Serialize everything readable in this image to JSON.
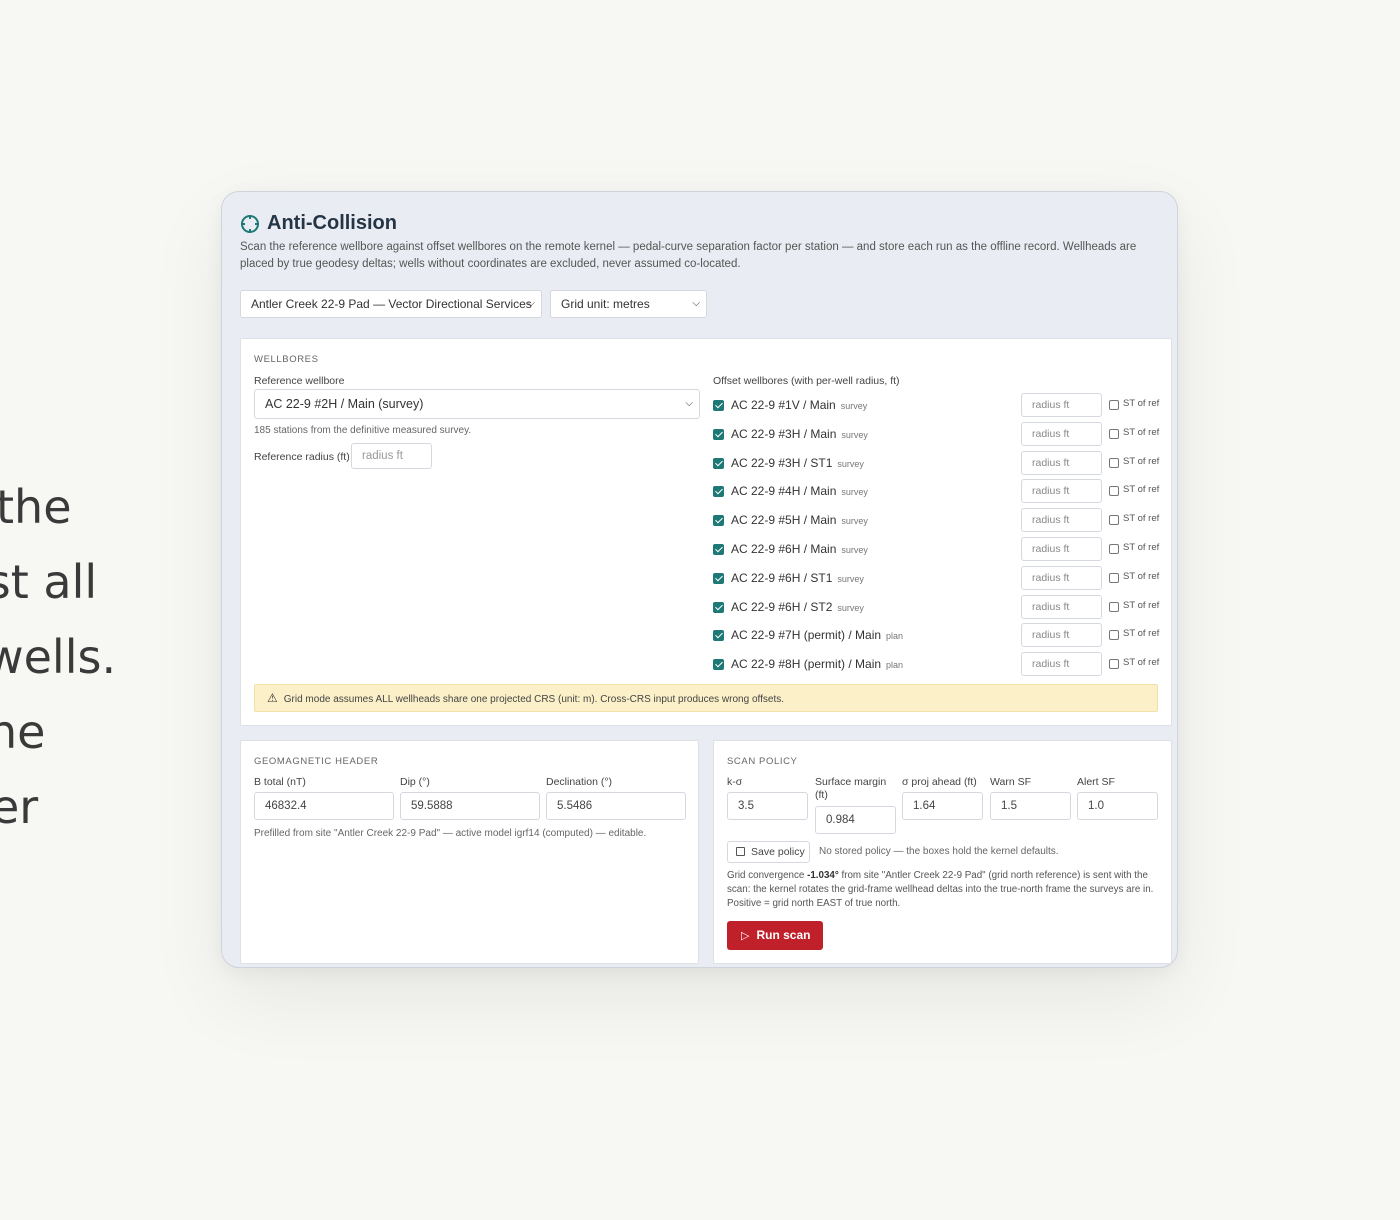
{
  "side_text": [
    "the",
    "ist all",
    "wells.",
    "he",
    "er"
  ],
  "app": {
    "title": "Anti-Collision",
    "description": "Scan the reference wellbore against offset wellbores on the remote kernel — pedal-curve separation factor per station — and store each run as the offline record. Wellheads are placed by true geodesy deltas; wells without coordinates are excluded, never assumed co-located."
  },
  "selectors": {
    "site": "Antler Creek 22-9 Pad — Vector Directional Services",
    "grid_unit": "Grid unit: metres"
  },
  "wellbores": {
    "section_label": "WELLBORES",
    "reference_label": "Reference wellbore",
    "reference_value": "AC 22-9 #2H / Main (survey)",
    "stations_hint": "185 stations from the definitive measured survey.",
    "ref_radius_label": "Reference radius (ft)",
    "ref_radius_placeholder": "radius ft",
    "offset_label": "Offset wellbores (with per-well radius, ft)",
    "offsets": [
      {
        "name": "AC 22-9 #1V / Main",
        "kind": "survey",
        "radius_placeholder": "radius ft",
        "st_label": "ST of ref"
      },
      {
        "name": "AC 22-9 #3H / Main",
        "kind": "survey",
        "radius_placeholder": "radius ft",
        "st_label": "ST of ref"
      },
      {
        "name": "AC 22-9 #3H / ST1",
        "kind": "survey",
        "radius_placeholder": "radius ft",
        "st_label": "ST of ref"
      },
      {
        "name": "AC 22-9 #4H / Main",
        "kind": "survey",
        "radius_placeholder": "radius ft",
        "st_label": "ST of ref"
      },
      {
        "name": "AC 22-9 #5H / Main",
        "kind": "survey",
        "radius_placeholder": "radius ft",
        "st_label": "ST of ref"
      },
      {
        "name": "AC 22-9 #6H / Main",
        "kind": "survey",
        "radius_placeholder": "radius ft",
        "st_label": "ST of ref"
      },
      {
        "name": "AC 22-9 #6H / ST1",
        "kind": "survey",
        "radius_placeholder": "radius ft",
        "st_label": "ST of ref"
      },
      {
        "name": "AC 22-9 #6H / ST2",
        "kind": "survey",
        "radius_placeholder": "radius ft",
        "st_label": "ST of ref"
      },
      {
        "name": "AC 22-9 #7H (permit) / Main",
        "kind": "plan",
        "radius_placeholder": "radius ft",
        "st_label": "ST of ref"
      },
      {
        "name": "AC 22-9 #8H (permit) / Main",
        "kind": "plan",
        "radius_placeholder": "radius ft",
        "st_label": "ST of ref"
      }
    ],
    "warning": "Grid mode assumes ALL wellheads share one projected CRS (unit: m). Cross-CRS input produces wrong offsets."
  },
  "geomagnetic": {
    "section_label": "GEOMAGNETIC HEADER",
    "fields": [
      {
        "label": "B total (nT)",
        "value": "46832.4"
      },
      {
        "label": "Dip (°)",
        "value": "59.5888"
      },
      {
        "label": "Declination (°)",
        "value": "5.5486"
      }
    ],
    "hint": "Prefilled from site \"Antler Creek 22-9 Pad\" — active model igrf14 (computed) — editable."
  },
  "scan_policy": {
    "section_label": "SCAN POLICY",
    "fields": [
      {
        "label": "k-σ",
        "value": "3.5"
      },
      {
        "label": "Surface margin (ft)",
        "value": "0.984"
      },
      {
        "label": "σ proj ahead (ft)",
        "value": "1.64"
      },
      {
        "label": "Warn SF",
        "value": "1.5"
      },
      {
        "label": "Alert SF",
        "value": "1.0"
      }
    ],
    "save_label": "Save policy",
    "save_hint": "No stored policy — the boxes hold the kernel defaults.",
    "convergence_prefix": "Grid convergence ",
    "convergence_value": "-1.034°",
    "convergence_suffix": " from site \"Antler Creek 22-9 Pad\" (grid north reference) is sent with the scan: the kernel rotates the grid-frame wellhead deltas into the true-north frame the surveys are in. Positive = grid north EAST of true north.",
    "run_label": "Run scan"
  }
}
